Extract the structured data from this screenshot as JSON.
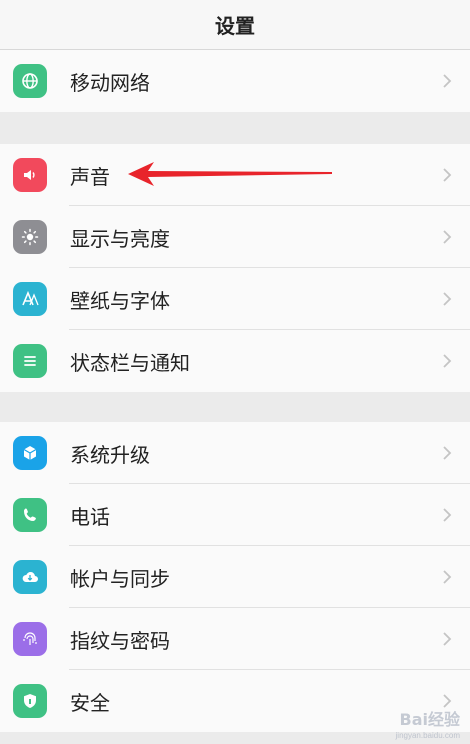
{
  "header": {
    "title": "设置"
  },
  "groups": [
    {
      "items": [
        {
          "label": "移动网络",
          "icon": "globe-icon",
          "color": "#3fc184"
        }
      ]
    },
    {
      "items": [
        {
          "label": "声音",
          "icon": "speaker-icon",
          "color": "#f2495c"
        },
        {
          "label": "显示与亮度",
          "icon": "brightness-icon",
          "color": "#8e8e93"
        },
        {
          "label": "壁纸与字体",
          "icon": "wallpaper-font-icon",
          "color": "#2bb3d1"
        },
        {
          "label": "状态栏与通知",
          "icon": "notification-list-icon",
          "color": "#3fc184"
        }
      ]
    },
    {
      "items": [
        {
          "label": "系统升级",
          "icon": "system-upgrade-icon",
          "color": "#1aa3e8"
        },
        {
          "label": "电话",
          "icon": "phone-icon",
          "color": "#3fc184"
        },
        {
          "label": "帐户与同步",
          "icon": "cloud-sync-icon",
          "color": "#2bb3d1"
        },
        {
          "label": "指纹与密码",
          "icon": "fingerprint-icon",
          "color": "#9b6ee8"
        },
        {
          "label": "安全",
          "icon": "shield-icon",
          "color": "#3fc184"
        }
      ]
    }
  ],
  "annotation": {
    "arrow_color": "#e8242b",
    "arrow_target": "声音"
  },
  "watermark": {
    "text": "Bai经验",
    "sub": "jingyan.baidu.com"
  }
}
